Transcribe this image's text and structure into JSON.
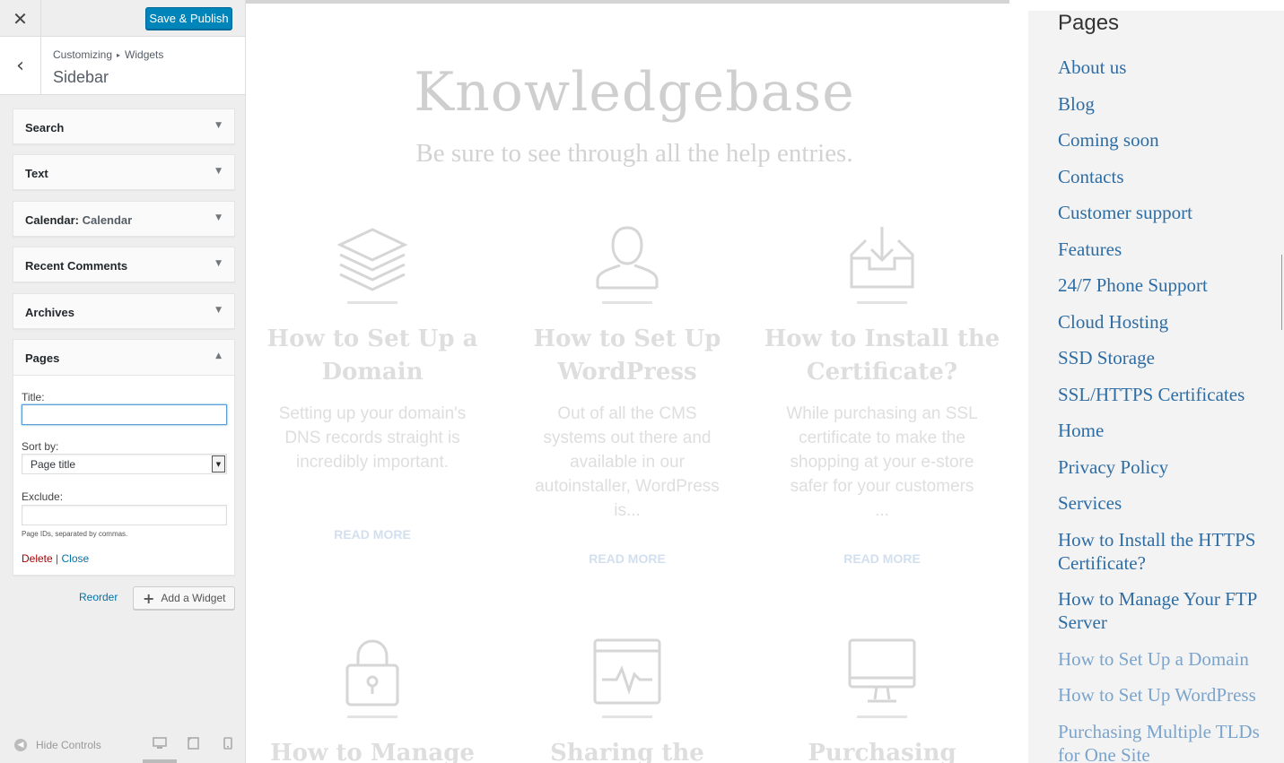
{
  "header": {
    "close_icon": "close-icon",
    "publish_label": "Save & Publish"
  },
  "title_bar": {
    "crumb_root": "Customizing",
    "crumb_sep": "▸",
    "crumb_leaf": "Widgets",
    "panel_name": "Sidebar"
  },
  "widgets": [
    {
      "label": "Search",
      "sub": ""
    },
    {
      "label": "Text",
      "sub": ""
    },
    {
      "label": "Calendar:",
      "sub": "Calendar"
    },
    {
      "label": "Recent Comments",
      "sub": ""
    },
    {
      "label": "Archives",
      "sub": ""
    },
    {
      "label": "Pages",
      "sub": ""
    }
  ],
  "pages_form": {
    "title_label": "Title:",
    "title_value": "",
    "sort_label": "Sort by:",
    "sort_value": "Page title",
    "exclude_label": "Exclude:",
    "exclude_value": "",
    "hint": "Page IDs, separated by commas.",
    "delete_label": "Delete",
    "separator": "|",
    "close_label": "Close"
  },
  "footer_actions": {
    "reorder_label": "Reorder",
    "add_widget_label": "Add a Widget"
  },
  "controls": {
    "hide_label": "Hide Controls"
  },
  "preview": {
    "title": "Knowledgebase",
    "subtitle": "Be sure to see through all the help entries.",
    "cards": [
      {
        "icon": "layers-icon",
        "title": "How to Set Up a Domain",
        "text": "Setting up your domain's DNS records straight is incredibly important.",
        "more": "READ MORE"
      },
      {
        "icon": "user-icon",
        "title": "How to Set Up WordPress",
        "text": "Out of all the CMS systems out there and available in our autoinstaller, WordPress is...",
        "more": "READ MORE"
      },
      {
        "icon": "inbox-download-icon",
        "title": "How to Install the Certificate?",
        "text": "While purchasing an SSL certificate to make the shopping at your e-store safer for your customers ...",
        "more": "READ MORE"
      },
      {
        "icon": "lock-icon",
        "title": "How to Manage",
        "text": "",
        "more": ""
      },
      {
        "icon": "browser-pulse-icon",
        "title": "Sharing the",
        "text": "",
        "more": ""
      },
      {
        "icon": "monitor-icon",
        "title": "Purchasing",
        "text": "",
        "more": ""
      }
    ]
  },
  "sidebar": {
    "title": "Pages",
    "items": [
      "About us",
      "Blog",
      "Coming soon",
      "Contacts",
      "Customer support",
      "Features",
      "24/7 Phone Support",
      "Cloud Hosting",
      "SSD Storage",
      "SSL/HTTPS Certificates",
      "Home",
      "Privacy Policy",
      "Services",
      "How to Install the HTTPS Certificate?",
      "How to Manage Your FTP Server",
      "How to Set Up a Domain",
      "How to Set Up WordPress",
      "Purchasing Multiple TLDs for One Site"
    ],
    "faded_from": 15
  },
  "colors": {
    "primary": "#0085ba",
    "link": "#0073aa",
    "delete": "#aa0000",
    "sidebar_link": "#2e6da4"
  }
}
